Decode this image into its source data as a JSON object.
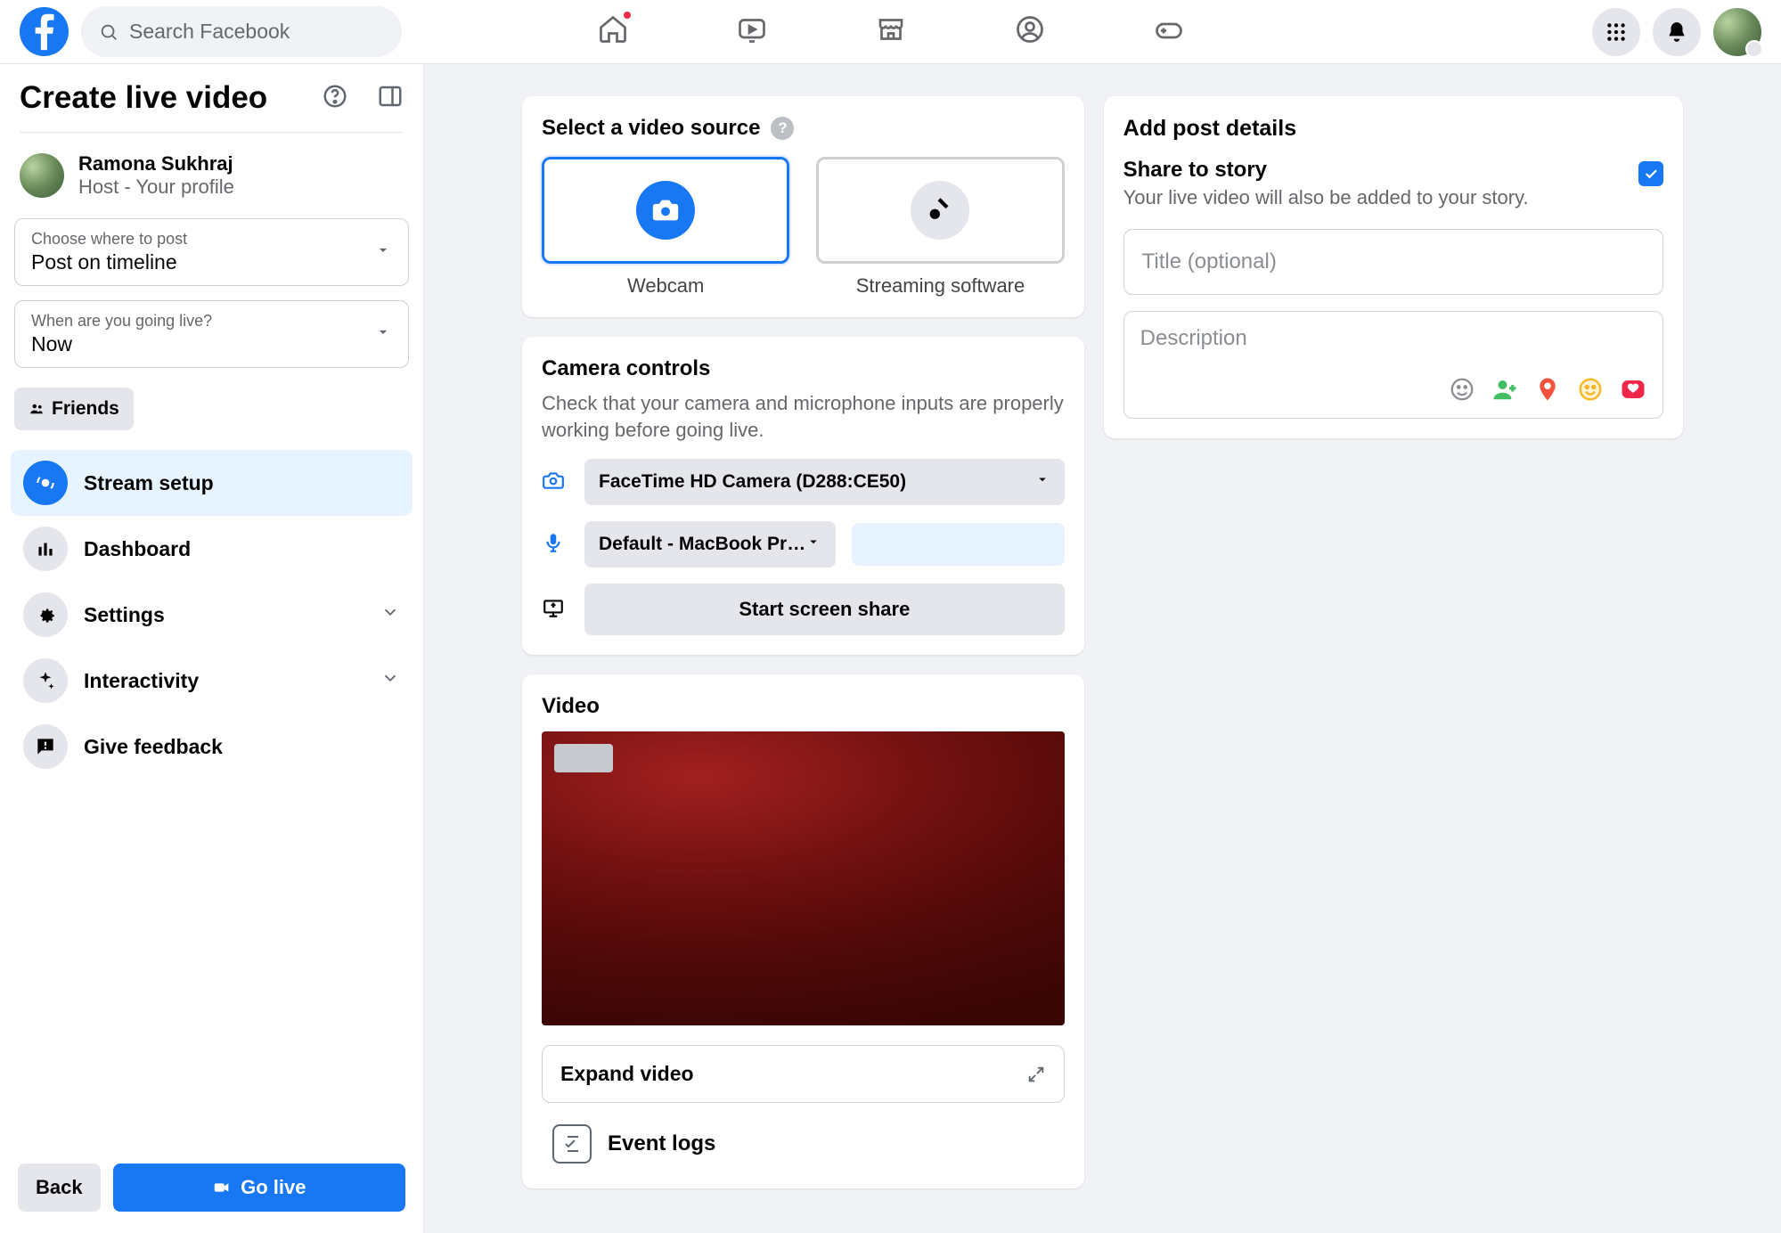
{
  "header": {
    "search_placeholder": "Search Facebook"
  },
  "sidebar": {
    "title": "Create live video",
    "host": {
      "name": "Ramona Sukhraj",
      "subtitle": "Host - Your profile"
    },
    "where": {
      "label": "Choose where to post",
      "value": "Post on timeline"
    },
    "when": {
      "label": "When are you going live?",
      "value": "Now"
    },
    "audience_chip": "Friends",
    "nav": {
      "stream_setup": "Stream setup",
      "dashboard": "Dashboard",
      "settings": "Settings",
      "interactivity": "Interactivity",
      "give_feedback": "Give feedback"
    },
    "footer": {
      "back": "Back",
      "go_live": "Go live"
    }
  },
  "source": {
    "heading": "Select a video source",
    "webcam": "Webcam",
    "streaming": "Streaming software"
  },
  "camera": {
    "heading": "Camera controls",
    "subtext": "Check that your camera and microphone inputs are properly working before going live.",
    "camera_device": "FaceTime HD Camera (D288:CE50)",
    "mic_device": "Default - MacBook Pr…",
    "screen_share": "Start screen share"
  },
  "video": {
    "heading": "Video",
    "expand": "Expand video",
    "event_logs": "Event logs"
  },
  "post": {
    "heading": "Add post details",
    "story_title": "Share to story",
    "story_sub": "Your live video will also be added to your story.",
    "title_placeholder": "Title (optional)",
    "desc_placeholder": "Description"
  }
}
